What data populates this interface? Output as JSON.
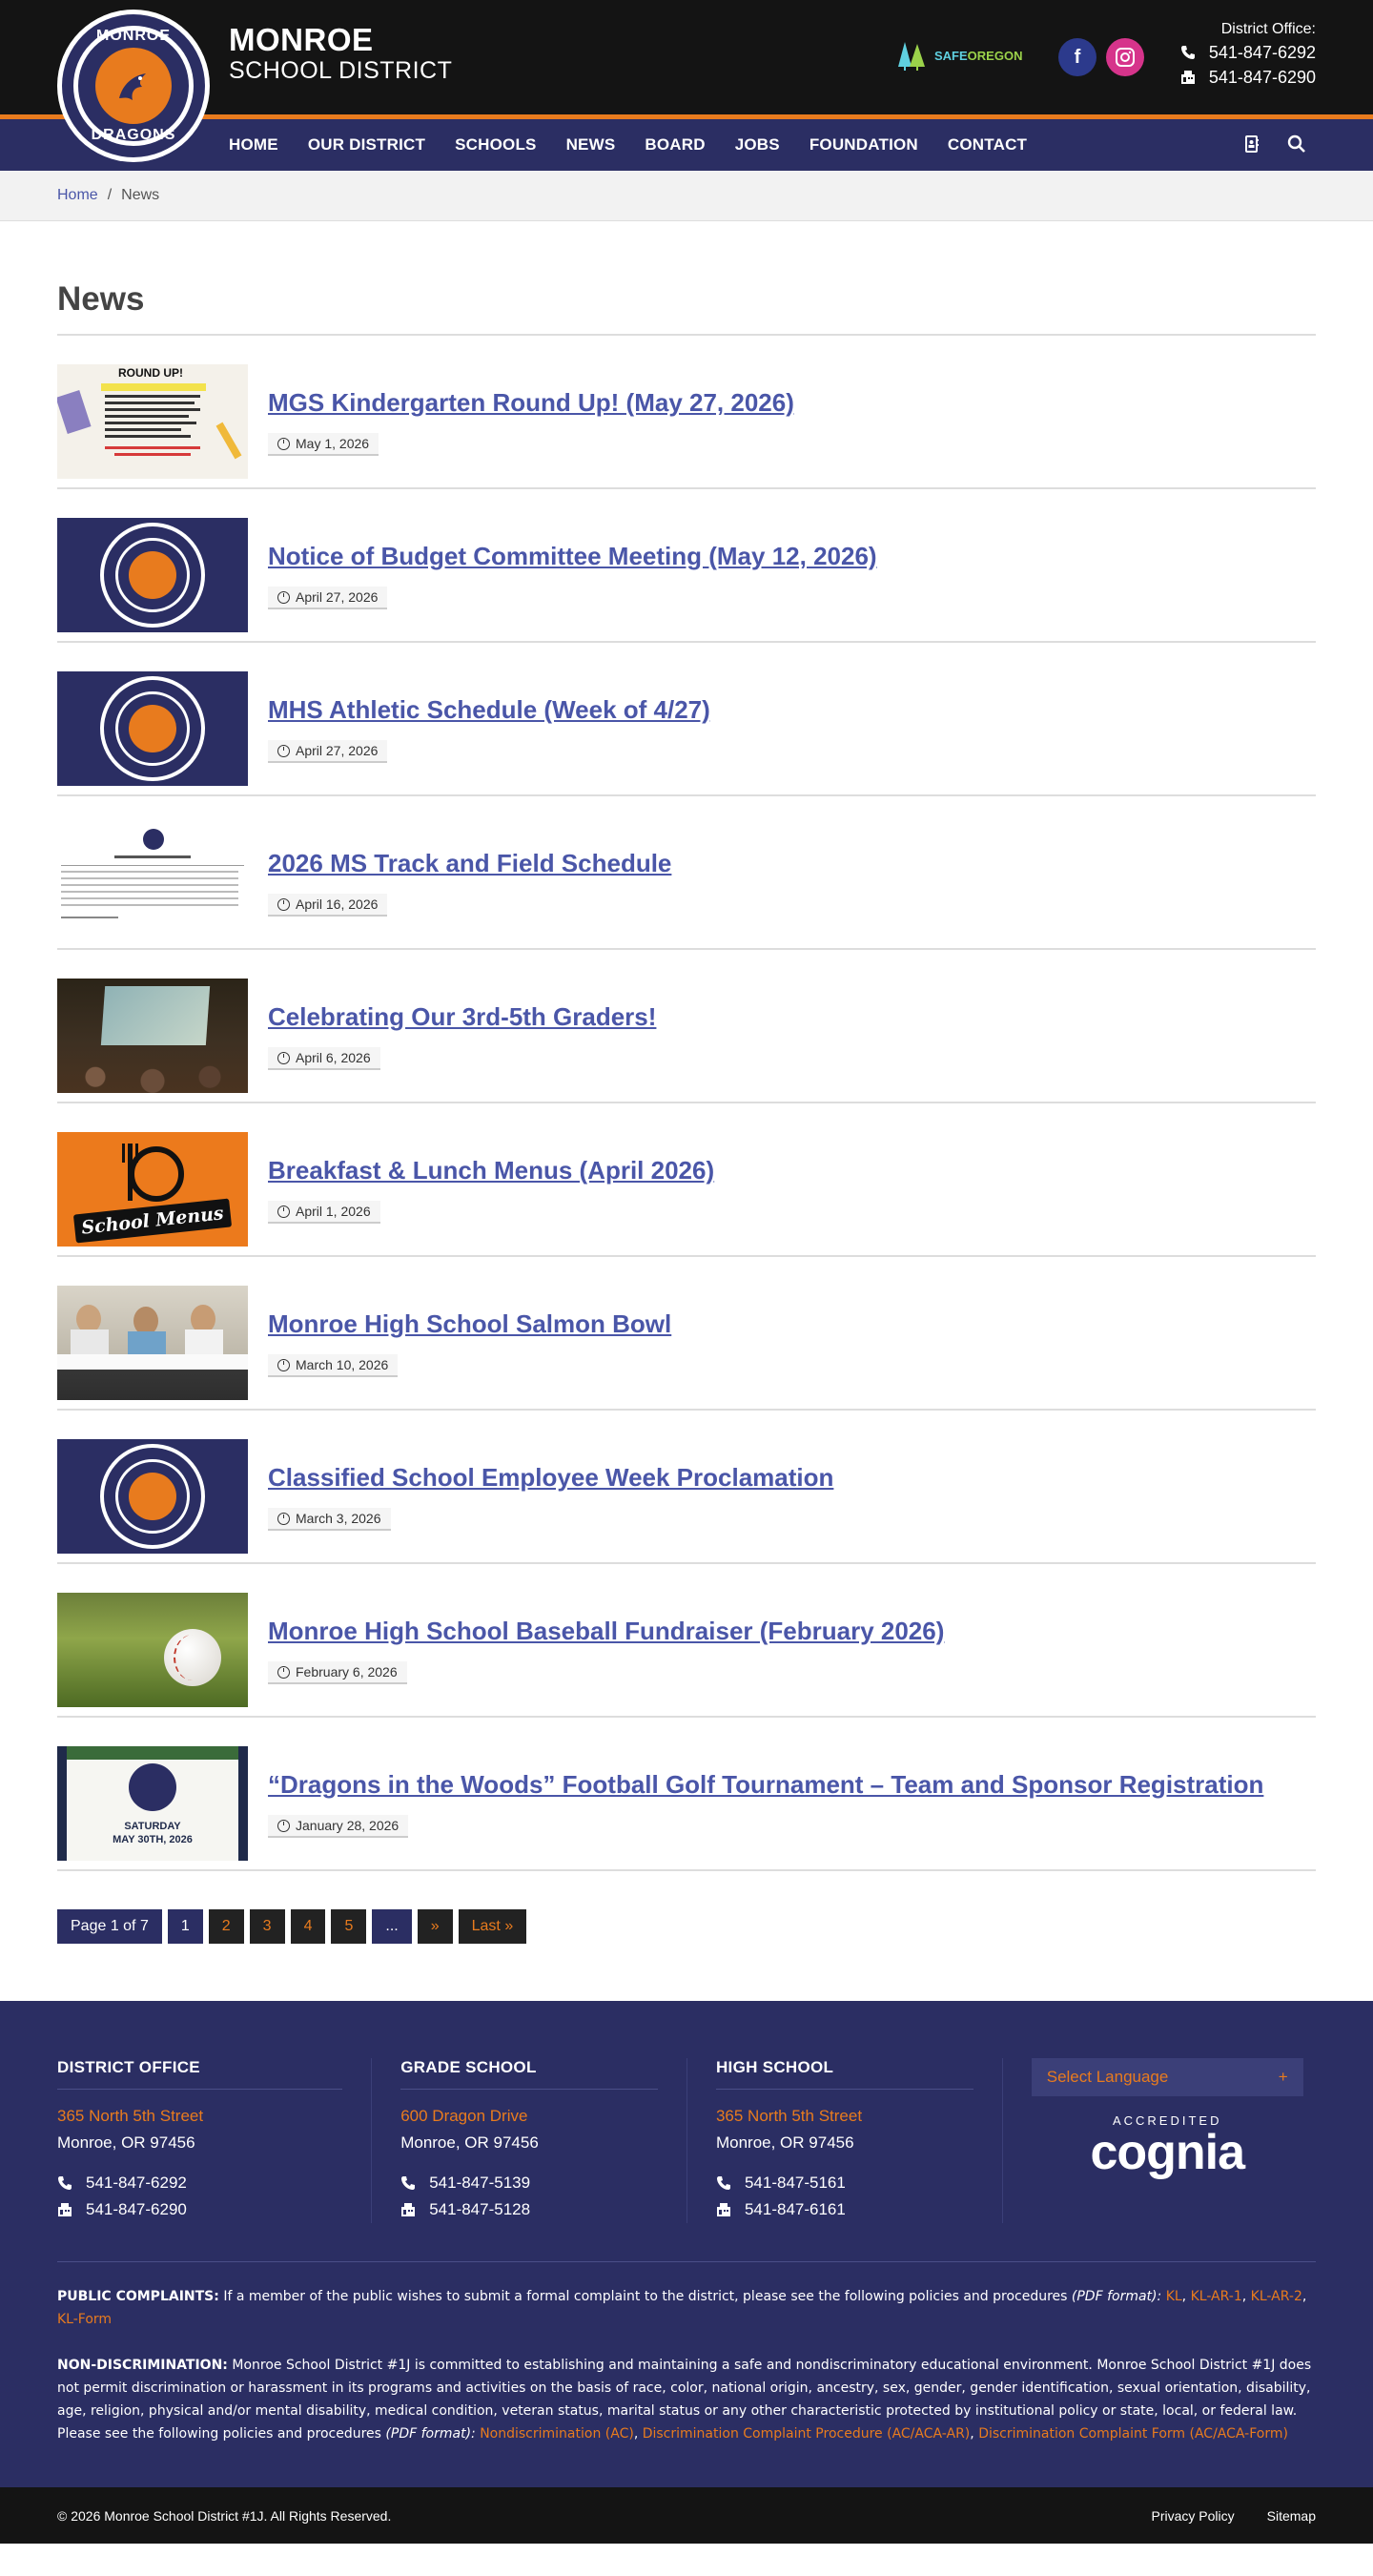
{
  "header": {
    "logo_top": "MONROE",
    "logo_bottom": "DRAGONS",
    "brand_line1": "MONROE",
    "brand_line2": "SCHOOL DISTRICT",
    "safe_oregon_a": "SAFE",
    "safe_oregon_b": "OREGON",
    "office_label": "District Office:",
    "office_phone": "541-847-6292",
    "office_fax": "541-847-6290"
  },
  "nav": {
    "items": [
      "HOME",
      "OUR DISTRICT",
      "SCHOOLS",
      "NEWS",
      "BOARD",
      "JOBS",
      "FOUNDATION",
      "CONTACT"
    ]
  },
  "breadcrumb": {
    "home": "Home",
    "sep": "/",
    "current": "News"
  },
  "main": {
    "title": "News",
    "posts": [
      {
        "title": "MGS Kindergarten Round Up! (May 27, 2026)",
        "date": "May 1, 2026",
        "thumb": "flyer"
      },
      {
        "title": "Notice of Budget Committee Meeting (May 12, 2026)",
        "date": "April 27, 2026",
        "thumb": "logo"
      },
      {
        "title": "MHS Athletic Schedule (Week of 4/27)",
        "date": "April 27, 2026",
        "thumb": "logo"
      },
      {
        "title": "2026 MS Track and Field Schedule",
        "date": "April 16, 2026",
        "thumb": "schedule"
      },
      {
        "title": "Celebrating Our 3rd-5th Graders!",
        "date": "April 6, 2026",
        "thumb": "photo-dark"
      },
      {
        "title": "Breakfast & Lunch Menus (April 2026)",
        "date": "April 1, 2026",
        "thumb": "menus"
      },
      {
        "title": "Monroe High School Salmon Bowl",
        "date": "March 10, 2026",
        "thumb": "photo-students"
      },
      {
        "title": "Classified School Employee Week Proclamation",
        "date": "March 3, 2026",
        "thumb": "logo"
      },
      {
        "title": "Monroe High School Baseball Fundraiser (February 2026)",
        "date": "February 6, 2026",
        "thumb": "baseball"
      },
      {
        "title": "“Dragons in the Woods” Football Golf Tournament – Team and Sponsor Registration",
        "date": "January 28, 2026",
        "thumb": "golf"
      }
    ],
    "thumb_text": {
      "flyer_title": "ROUND UP!",
      "menus_text": "School Menus",
      "golf_day": "SATURDAY",
      "golf_date": "MAY 30TH, 2026"
    },
    "pager": {
      "current": "Page 1 of 7",
      "pages": [
        "1",
        "2",
        "3",
        "4",
        "5"
      ],
      "ellipsis": "...",
      "next": "»",
      "last": "Last »"
    }
  },
  "footer": {
    "cols": [
      {
        "title": "DISTRICT OFFICE",
        "addr": "365 North 5th Street",
        "city": "Monroe, OR 97456",
        "phone": "541-847-6292",
        "fax": "541-847-6290"
      },
      {
        "title": "GRADE SCHOOL",
        "addr": "600 Dragon Drive",
        "city": "Monroe, OR 97456",
        "phone": "541-847-5139",
        "fax": "541-847-5128"
      },
      {
        "title": "HIGH SCHOOL",
        "addr": "365 North 5th Street",
        "city": "Monroe, OR 97456",
        "phone": "541-847-5161",
        "fax": "541-847-6161"
      }
    ],
    "language": "Select Language",
    "language_icon": "+",
    "accredited": "ACCREDITED",
    "cognia": "cognia",
    "complaints_label": "PUBLIC COMPLAINTS:",
    "complaints_text": "If a member of the public wishes to submit a formal complaint to the district, please see the following policies and procedures",
    "pdf_format": "(PDF format):",
    "complaint_links": [
      "KL",
      "KL-AR-1",
      "KL-AR-2",
      "KL-Form"
    ],
    "nondisc_label": "NON-DISCRIMINATION:",
    "nondisc_text": "Monroe School District #1J is committed to establishing and maintaining a safe and nondiscriminatory educational environment. Monroe School District #1J does not permit discrimination or harassment in its programs and activities on the basis of race, color, national origin, ancestry, sex, gender, gender identification, sexual orientation, disability, age, religion, physical and/or mental disability, medical condition, veteran status, marital status or any other characteristic protected by institutional policy or state, local, or federal law. Please see the following policies and procedures",
    "nondisc_links": [
      "Nondiscrimination (AC)",
      "Discrimination Complaint Procedure (AC/ACA-AR)",
      "Discrimination Complaint Form (AC/ACA-Form)"
    ],
    "copyright": "© 2026 Monroe School District #1J. All Rights Reserved.",
    "privacy": "Privacy Policy",
    "sitemap": "Sitemap"
  },
  "colors": {
    "navy": "#2b2e63",
    "orange": "#e87b1e",
    "link": "#4a56a8",
    "dark": "#141414"
  },
  "icons": [
    "facebook-icon",
    "instagram-icon",
    "phone-icon",
    "fax-icon",
    "search-icon",
    "directory-icon",
    "clock-icon",
    "dragon-icon"
  ]
}
